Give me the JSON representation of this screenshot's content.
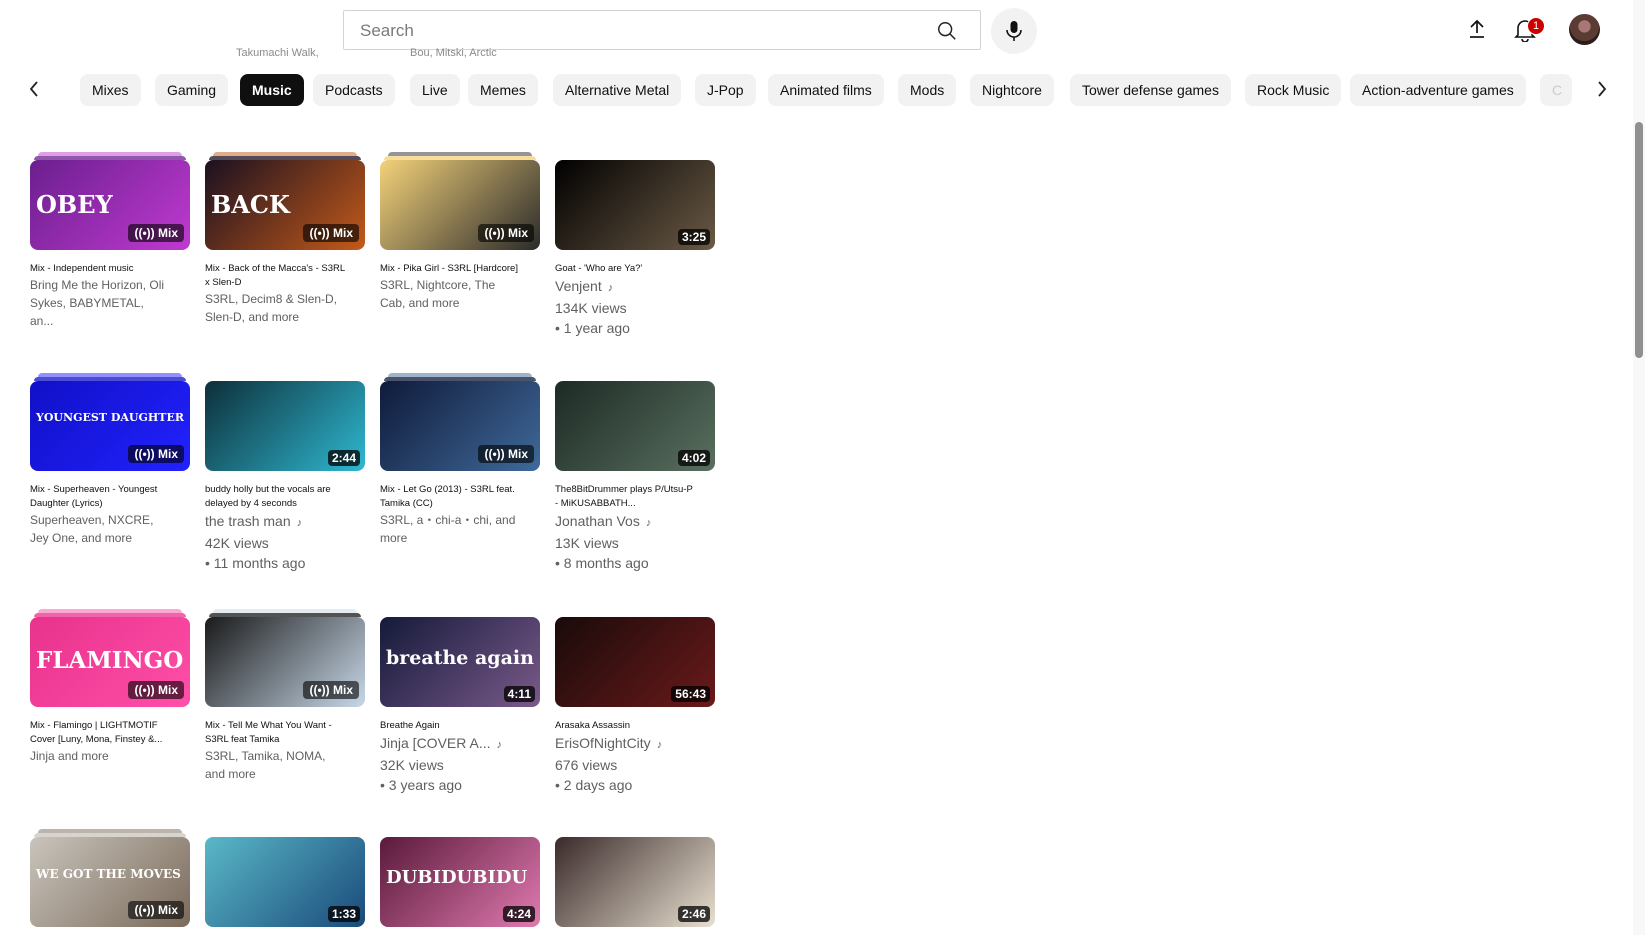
{
  "search": {
    "placeholder": "Search"
  },
  "header": {
    "notification_count": "1"
  },
  "overflow": {
    "left": "Takumachi Walk,",
    "right": "Bou, Mitski, Arctic"
  },
  "chips": [
    "Mixes",
    "Gaming",
    "Music",
    "Podcasts",
    "Live",
    "Memes",
    "Alternative Metal",
    "J-Pop",
    "Animated films",
    "Mods",
    "Nightcore",
    "Tower defense games",
    "Rock Music",
    "Action-adventure games",
    "C"
  ],
  "active_chip": "Music",
  "videos": [
    {
      "title": "Mix - Independent music",
      "channel": "Bring Me the Horizon, Oli Sykes, BABYMETAL, an...",
      "badge": "Mix",
      "thumb_text": "OBEY",
      "colors": [
        "#6b1f8f",
        "#c03ad0"
      ]
    },
    {
      "title": "Mix - Back of the Macca's - S3RL x Slen-D",
      "channel": "S3RL, Decim8 & Slen-D, Slen-D, and more",
      "badge": "Mix",
      "thumb_text": "BACK",
      "colors": [
        "#1a1020",
        "#c45a1a"
      ]
    },
    {
      "title": "Mix - Pika Girl - S3RL [Hardcore]",
      "channel": "S3RL, Nightcore, The Cab, and more",
      "badge": "Mix",
      "thumb_text": "",
      "colors": [
        "#f4d27a",
        "#2a2a2a"
      ]
    },
    {
      "title": "Goat - 'Who are Ya?'",
      "channel": "Venjent",
      "views": "134K views",
      "age": "• 1 year ago",
      "duration": "3:25",
      "thumb_text": "",
      "colors": [
        "#000000",
        "#6b5a45"
      ]
    },
    {
      "title": "Mix - Superheaven - Youngest Daughter (Lyrics)",
      "channel": "Superheaven, NXCRE, Jey One, and more",
      "badge": "Mix",
      "thumb_text": "YOUNGEST DAUGHTER",
      "colors": [
        "#1010c8",
        "#2222ff"
      ]
    },
    {
      "title": "buddy holly but the vocals are delayed by 4 seconds",
      "channel": "the trash man",
      "views": "42K views",
      "age": "• 11 months ago",
      "duration": "2:44",
      "thumb_text": "",
      "colors": [
        "#0d2f3a",
        "#2fb8d0"
      ]
    },
    {
      "title": "Mix - Let Go (2013) - S3RL feat. Tamika (CC)",
      "channel": "S3RL, a・chi-a・chi, and more",
      "badge": "Mix",
      "thumb_text": "",
      "colors": [
        "#0f1a3a",
        "#3f6a9a"
      ]
    },
    {
      "title": "The8BitDrummer plays P/Utsu-P - MiKUSABBATH...",
      "channel": "Jonathan Vos",
      "views": "13K views",
      "age": "• 8 months ago",
      "duration": "4:02",
      "thumb_text": "",
      "colors": [
        "#1c2a24",
        "#5a7060"
      ]
    },
    {
      "title": "Mix - Flamingo | LIGHTMOTIF Cover [Luny, Mona, Finstey &...",
      "channel": "Jinja and more",
      "badge": "Mix",
      "thumb_text": "FLAMINGO",
      "colors": [
        "#e8328c",
        "#ff4fa8"
      ]
    },
    {
      "title": "Mix - Tell Me What You Want - S3RL feat Tamika",
      "channel": "S3RL, Tamika, NOMA, and more",
      "badge": "Mix",
      "thumb_text": "",
      "colors": [
        "#1a1a1a",
        "#c8d8e8"
      ]
    },
    {
      "title": "Breathe Again",
      "channel": "Jinja [COVER A...",
      "views": "32K views",
      "age": "• 3 years ago",
      "duration": "4:11",
      "thumb_text": "breathe again",
      "colors": [
        "#141a3a",
        "#7a5a8a"
      ]
    },
    {
      "title": "Arasaka Assassin",
      "channel": "ErisOfNightCity",
      "views": "676 views",
      "age": "• 2 days ago",
      "duration": "56:43",
      "thumb_text": "",
      "colors": [
        "#1a0a0a",
        "#6a1a1a"
      ]
    },
    {
      "title": "",
      "channel": "",
      "badge": "Mix",
      "thumb_text": "WE GOT THE MOVES",
      "colors": [
        "#c9c4bc",
        "#7a6a5a"
      ]
    },
    {
      "title": "",
      "channel": "",
      "duration": "1:33",
      "thumb_text": "",
      "colors": [
        "#5ab8c8",
        "#1a4a7a"
      ]
    },
    {
      "title": "",
      "channel": "",
      "duration": "4:24",
      "thumb_text": "DUBIDUBIDU",
      "colors": [
        "#5a1a3a",
        "#e07ab0"
      ]
    },
    {
      "title": "",
      "channel": "",
      "duration": "2:46",
      "thumb_text": "",
      "colors": [
        "#3a2a2a",
        "#e8e0d0"
      ]
    }
  ]
}
